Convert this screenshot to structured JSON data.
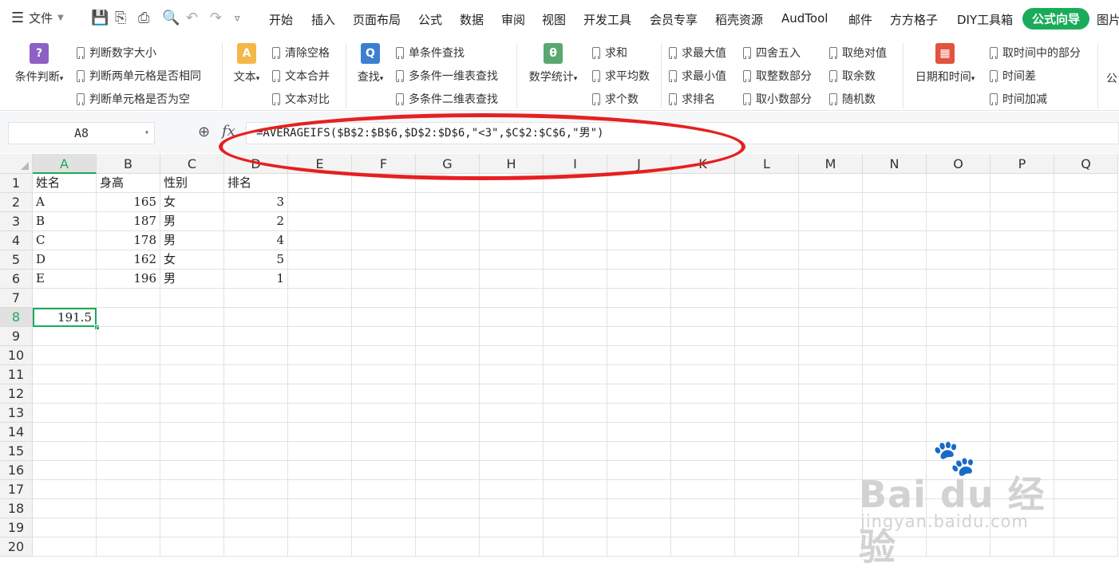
{
  "toolbar": {
    "menu_icon": "hamburger-icon",
    "file_label": "文件",
    "quick_icons": [
      "save-icon",
      "export-pdf-icon",
      "print-icon",
      "print-preview-icon",
      "undo-icon",
      "redo-icon",
      "more-icon"
    ],
    "tabs": [
      "开始",
      "插入",
      "页面布局",
      "公式",
      "数据",
      "审阅",
      "视图",
      "开发工具",
      "会员专享",
      "稻壳资源",
      "AudTool",
      "邮件",
      "方方格子",
      "DIY工具箱",
      "公式向导",
      "图片"
    ],
    "active_tab": "公式向导"
  },
  "ribbon": {
    "condition": {
      "label": "条件判断",
      "icon": "question-icon",
      "items": [
        "判断数字大小",
        "判断两单元格是否相同",
        "判断单元格是否为空"
      ]
    },
    "text": {
      "label": "文本",
      "icon": "text-a-icon",
      "items": [
        "清除空格",
        "文本合并",
        "文本对比"
      ]
    },
    "lookup": {
      "label": "查找",
      "icon": "lookup-icon",
      "items": [
        "单条件查找",
        "多条件一维表查找",
        "多条件二维表查找"
      ]
    },
    "math": {
      "label": "数学统计",
      "icon": "theta-icon",
      "items": [
        "求和",
        "求平均数",
        "求个数",
        "求最大值",
        "求最小值",
        "求排名",
        "四舍五入",
        "取整数部分",
        "取小数部分",
        "取绝对值",
        "取余数",
        "随机数"
      ]
    },
    "datetime": {
      "label": "日期和时间",
      "icon": "calendar-icon",
      "items": [
        "取时间中的部分",
        "时间差",
        "时间加减"
      ]
    },
    "more_label": "公"
  },
  "formula_bar": {
    "name_box": "A8",
    "formula": "=AVERAGEIFS($B$2:$B$6,$D$2:$D$6,\"<3\",$C$2:$C$6,\"男\")"
  },
  "sheet": {
    "columns": [
      "A",
      "B",
      "C",
      "D",
      "E",
      "F",
      "G",
      "H",
      "I",
      "J",
      "K",
      "L",
      "M",
      "N",
      "O",
      "P",
      "Q"
    ],
    "rows": [
      "1",
      "2",
      "3",
      "4",
      "5",
      "6",
      "7",
      "8",
      "9",
      "10",
      "11",
      "12",
      "13",
      "14",
      "15",
      "16",
      "17",
      "18",
      "19",
      "20"
    ],
    "header_row": [
      "姓名",
      "身高",
      "性别",
      "排名"
    ],
    "data": [
      [
        "A",
        "165",
        "女",
        "3"
      ],
      [
        "B",
        "187",
        "男",
        "2"
      ],
      [
        "C",
        "178",
        "男",
        "4"
      ],
      [
        "D",
        "162",
        "女",
        "5"
      ],
      [
        "E",
        "196",
        "男",
        "1"
      ]
    ],
    "result_cell": "191.5",
    "active_column": "A",
    "active_row": "8"
  },
  "watermark": {
    "brand": "Bai du 经验",
    "url": "jingyan.baidu.com"
  },
  "colors": {
    "accent": "#1aab5a",
    "annotation": "#e62020"
  }
}
